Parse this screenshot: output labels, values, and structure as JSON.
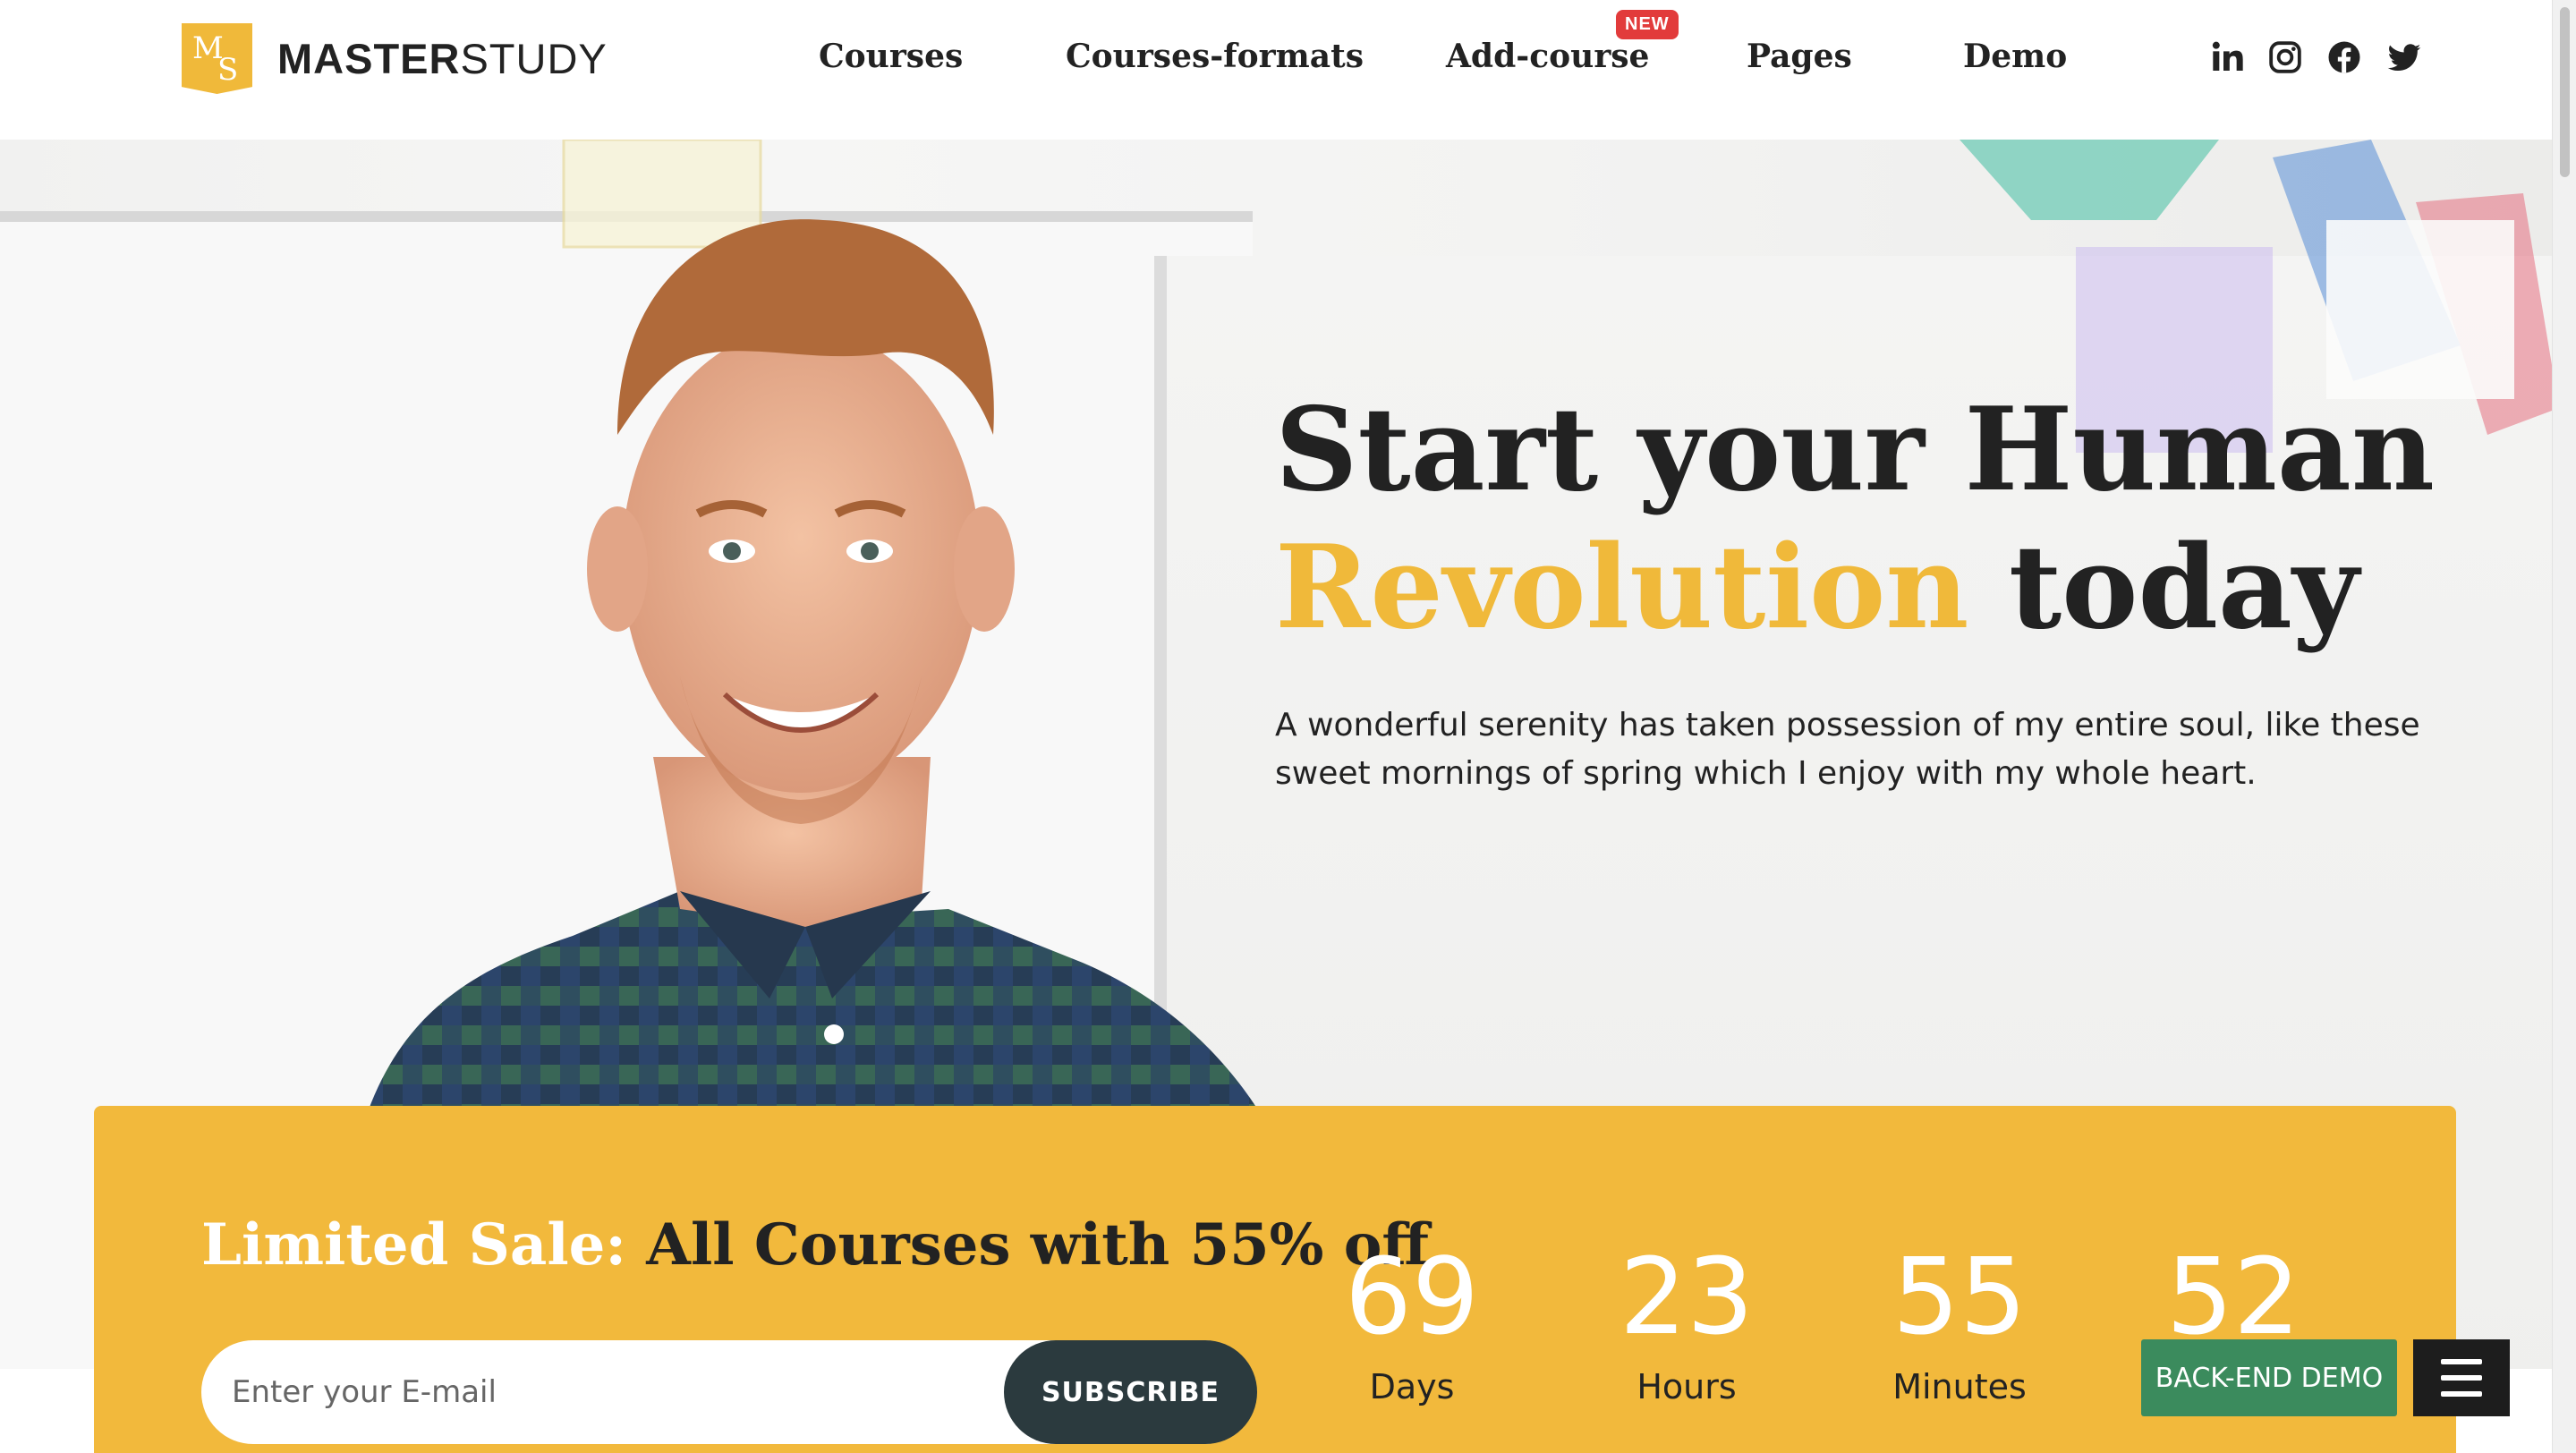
{
  "brand": {
    "logo_initials_m": "M",
    "logo_initials_s": "S",
    "name_bold": "MASTER",
    "name_light": "STUDY",
    "accent_color": "#f0b93a"
  },
  "nav": {
    "items": [
      {
        "label": "Courses"
      },
      {
        "label": "Courses-formats"
      },
      {
        "label": "Add-course",
        "badge": "NEW"
      },
      {
        "label": "Pages"
      },
      {
        "label": "Demo"
      }
    ]
  },
  "social": [
    {
      "icon": "linkedin-icon"
    },
    {
      "icon": "instagram-icon"
    },
    {
      "icon": "facebook-icon"
    },
    {
      "icon": "twitter-icon"
    }
  ],
  "hero": {
    "headline_part1": "Start your Human",
    "headline_accent": "Revolution",
    "headline_part2": "today",
    "text": "A wonderful serenity has taken possession of my entire soul, like these sweet mornings of spring which I enjoy with my whole heart."
  },
  "sale": {
    "label": "Limited Sale:",
    "title": "All Courses with 55% off",
    "email_placeholder": "Enter your E-mail",
    "subscribe_label": "SUBSCRIBE",
    "panel_color": "#f2b93c",
    "countdown": [
      {
        "value": "69",
        "label": "Days"
      },
      {
        "value": "23",
        "label": "Hours"
      },
      {
        "value": "55",
        "label": "Minutes"
      },
      {
        "value": "52",
        "label": ""
      }
    ]
  },
  "floating": {
    "backend_demo_label": "BACK-END DEMO",
    "button_color": "#3b8b5d"
  }
}
